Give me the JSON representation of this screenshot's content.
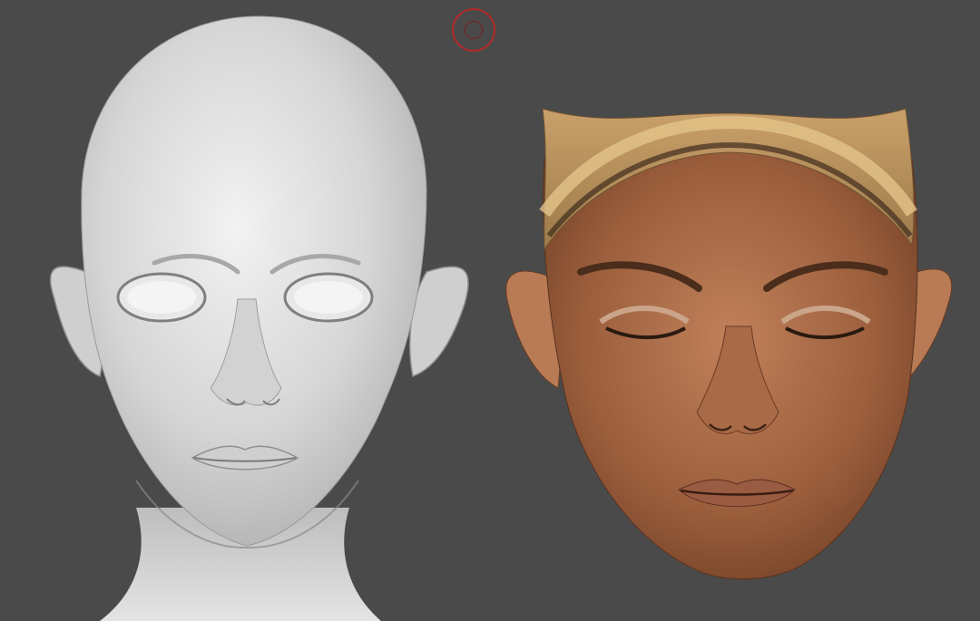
{
  "viewport": {
    "background_color": "#4a4a4a",
    "brush_cursor_color": "#b32a2a"
  },
  "models": [
    {
      "id": "sculpt",
      "material": "clay",
      "color": "#d9d9d9"
    },
    {
      "id": "scan",
      "material": "textured-skin",
      "color": "#a86a47"
    }
  ]
}
